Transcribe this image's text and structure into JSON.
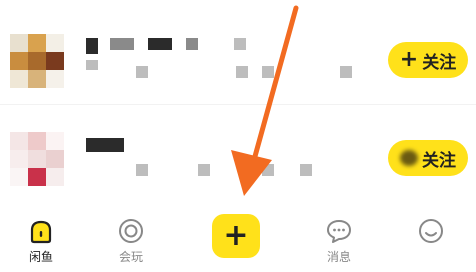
{
  "feed": {
    "items": [
      {
        "follow_label": "关注",
        "follow_icon": "plus-icon"
      },
      {
        "follow_label": "关注",
        "follow_icon": "plus-icon"
      }
    ]
  },
  "tabbar": {
    "tabs": [
      {
        "label": "闲鱼",
        "icon": "fish-home-icon",
        "active": true
      },
      {
        "label": "会玩",
        "icon": "circle-target-icon",
        "active": false
      },
      {
        "label": "",
        "icon": "plus-icon",
        "active": false
      },
      {
        "label": "消息",
        "icon": "chat-bubble-icon",
        "active": false
      },
      {
        "label": "",
        "icon": "smiley-icon",
        "active": false
      }
    ],
    "publish_symbol": "+"
  },
  "colors": {
    "accent": "#ffe11a",
    "annotation_arrow": "#f26b21"
  }
}
